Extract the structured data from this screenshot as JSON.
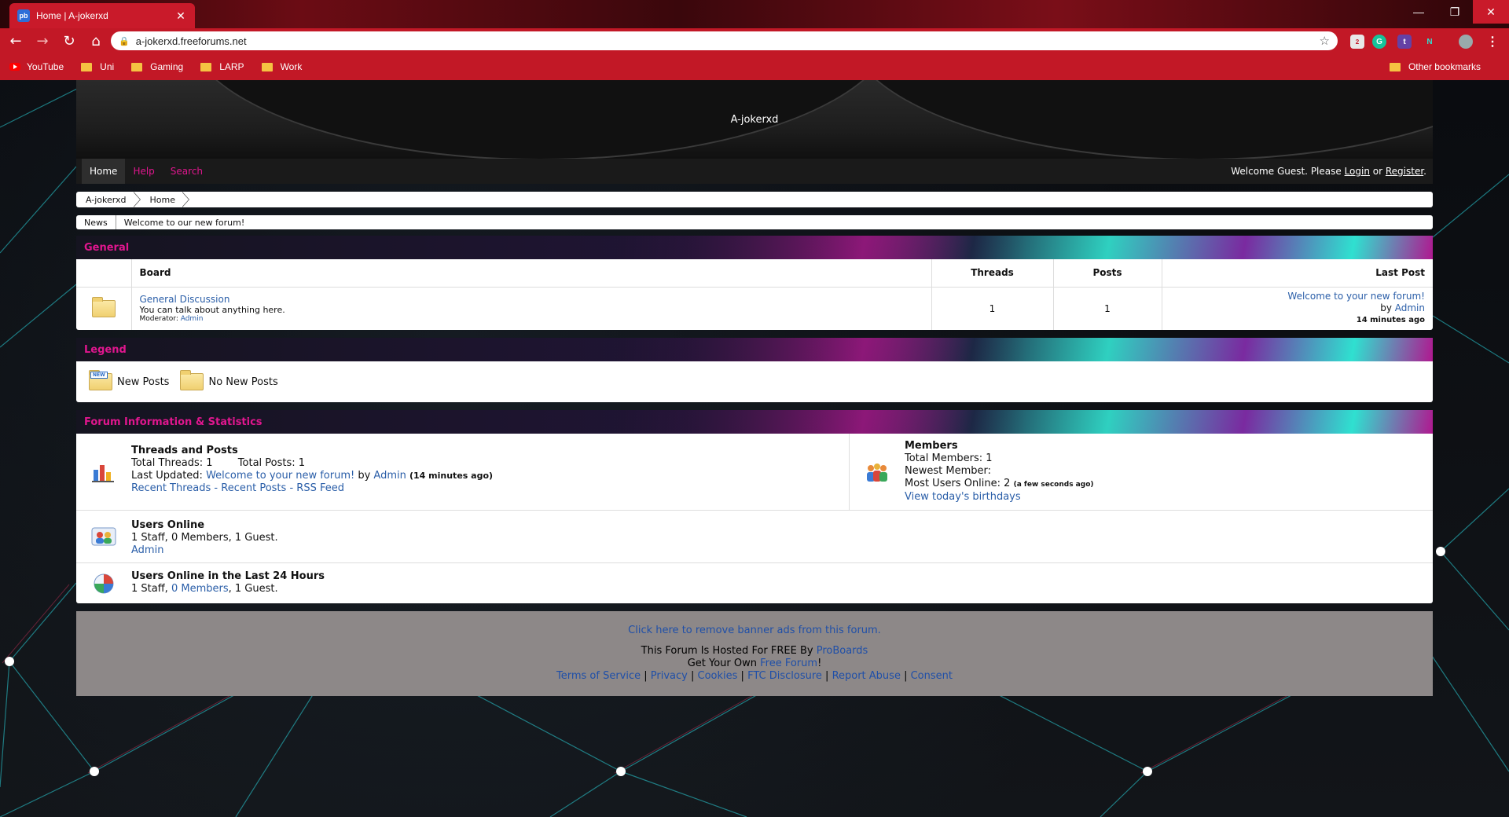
{
  "browser": {
    "tab_title": "Home | A-jokerxd",
    "favicon_text": "pb",
    "url": "a-jokerxd.freeforums.net",
    "bookmarks": [
      {
        "label": "YouTube",
        "icon": "youtube-icon"
      },
      {
        "label": "Uni",
        "icon": "folder-icon"
      },
      {
        "label": "Gaming",
        "icon": "folder-icon"
      },
      {
        "label": "LARP",
        "icon": "folder-icon"
      },
      {
        "label": "Work",
        "icon": "folder-icon"
      }
    ],
    "other_bookmarks": "Other bookmarks",
    "extension_badge": "2",
    "accent_color": "#c21826"
  },
  "site": {
    "title": "A-jokerxd"
  },
  "nav": {
    "items": [
      "Home",
      "Help",
      "Search"
    ],
    "welcome_prefix": "Welcome Guest. Please ",
    "login": "Login",
    "or": " or ",
    "register": "Register",
    "suffix": "."
  },
  "breadcrumb": [
    "A-jokerxd",
    "Home"
  ],
  "news": {
    "label": "News",
    "text": "Welcome to our new forum!"
  },
  "general": {
    "title": "General",
    "columns": [
      "Board",
      "Threads",
      "Posts",
      "Last Post"
    ],
    "boards": [
      {
        "name": "General Discussion",
        "description": "You can talk about anything here.",
        "moderator_label": "Moderator: ",
        "moderator": "Admin",
        "threads": "1",
        "posts": "1",
        "last_post_title": "Welcome to your new forum!",
        "last_post_by": "by ",
        "last_post_user": "Admin",
        "last_post_time": "14 minutes ago"
      }
    ]
  },
  "legend": {
    "title": "Legend",
    "new_badge": "NEW",
    "new_posts": "New Posts",
    "no_new_posts": "No New Posts"
  },
  "stats": {
    "title": "Forum Information & Statistics",
    "threads_posts": {
      "heading": "Threads and Posts",
      "total_threads_label": "Total Threads: ",
      "total_threads": "1",
      "total_posts_label": "Total Posts: ",
      "total_posts": "1",
      "last_updated_label": "Last Updated: ",
      "last_updated_title": "Welcome to your new forum!",
      "by": " by ",
      "user": "Admin",
      "time": "(14 minutes ago)",
      "recent_threads": "Recent Threads",
      "sep": " - ",
      "recent_posts": "Recent Posts",
      "rss": "RSS Feed"
    },
    "members": {
      "heading": "Members",
      "total_label": "Total Members: ",
      "total": "1",
      "newest_label": "Newest Member:",
      "most_online_label": "Most Users Online: ",
      "most_online": "2",
      "most_online_time": "(a few seconds ago)",
      "birthdays": "View today's birthdays"
    },
    "users_online": {
      "heading": "Users Online",
      "summary": "1 Staff, 0 Members, 1 Guest.",
      "user": "Admin"
    },
    "users_24h": {
      "heading": "Users Online in the Last 24 Hours",
      "staff": "1 Staff, ",
      "members": "0 Members",
      "guests": ", 1 Guest."
    }
  },
  "footer": {
    "remove_ads": "Click here to remove banner ads from this forum.",
    "hosted_prefix": "This Forum Is Hosted For FREE By ",
    "hosted_link": "ProBoards",
    "own_prefix": "Get Your Own ",
    "own_link": "Free Forum",
    "own_suffix": "!",
    "links": [
      "Terms of Service",
      "Privacy",
      "Cookies",
      "FTC Disclosure",
      "Report Abuse",
      "Consent"
    ],
    "sep": " | "
  }
}
